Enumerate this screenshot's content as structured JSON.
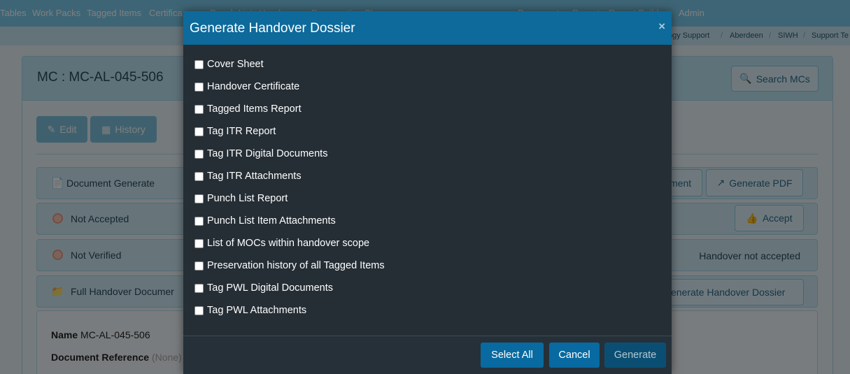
{
  "nav": {
    "items": [
      "Tables",
      "Work Packs",
      "Tagged Items",
      "Certifica",
      "Punch List",
      "Handover",
      "Preservation",
      "Changes",
      "Documents",
      "Reports",
      "Report Builder",
      "Admin"
    ]
  },
  "breadcrumbs": [
    "ogy Support",
    "Aberdeen",
    "SIWH",
    "Support Te"
  ],
  "page": {
    "mc_title": "MC : MC-AL-045-506",
    "search_label": "Search MCs",
    "edit_label": "Edit",
    "history_label": "History"
  },
  "rows": {
    "document_generate": "Document Generate",
    "generate_document_partial": "ment",
    "generate_pdf": "Generate PDF",
    "not_accepted": "Not Accepted",
    "accept": "Accept",
    "not_verified": "Not Verified",
    "handover_status": "Handover not accepted",
    "full_handover": "Full Handover Documer",
    "generate_dossier_partial": "enerate Handover Dossier"
  },
  "details": {
    "name_label": "Name",
    "name_value": "MC-AL-045-506",
    "docref_label": "Document Reference",
    "docref_value": "(None)"
  },
  "modal": {
    "title": "Generate Handover Dossier",
    "close": "×",
    "options": [
      "Cover Sheet",
      "Handover Certificate",
      "Tagged Items Report",
      "Tag ITR Report",
      "Tag ITR Digital Documents",
      "Tag ITR Attachments",
      "Punch List Report",
      "Punch List Item Attachments",
      "List of MOCs within handover scope",
      "Preservation history of all Tagged Items",
      "Tag PWL Digital Documents",
      "Tag PWL Attachments"
    ],
    "select_all": "Select All",
    "cancel": "Cancel",
    "generate": "Generate"
  }
}
